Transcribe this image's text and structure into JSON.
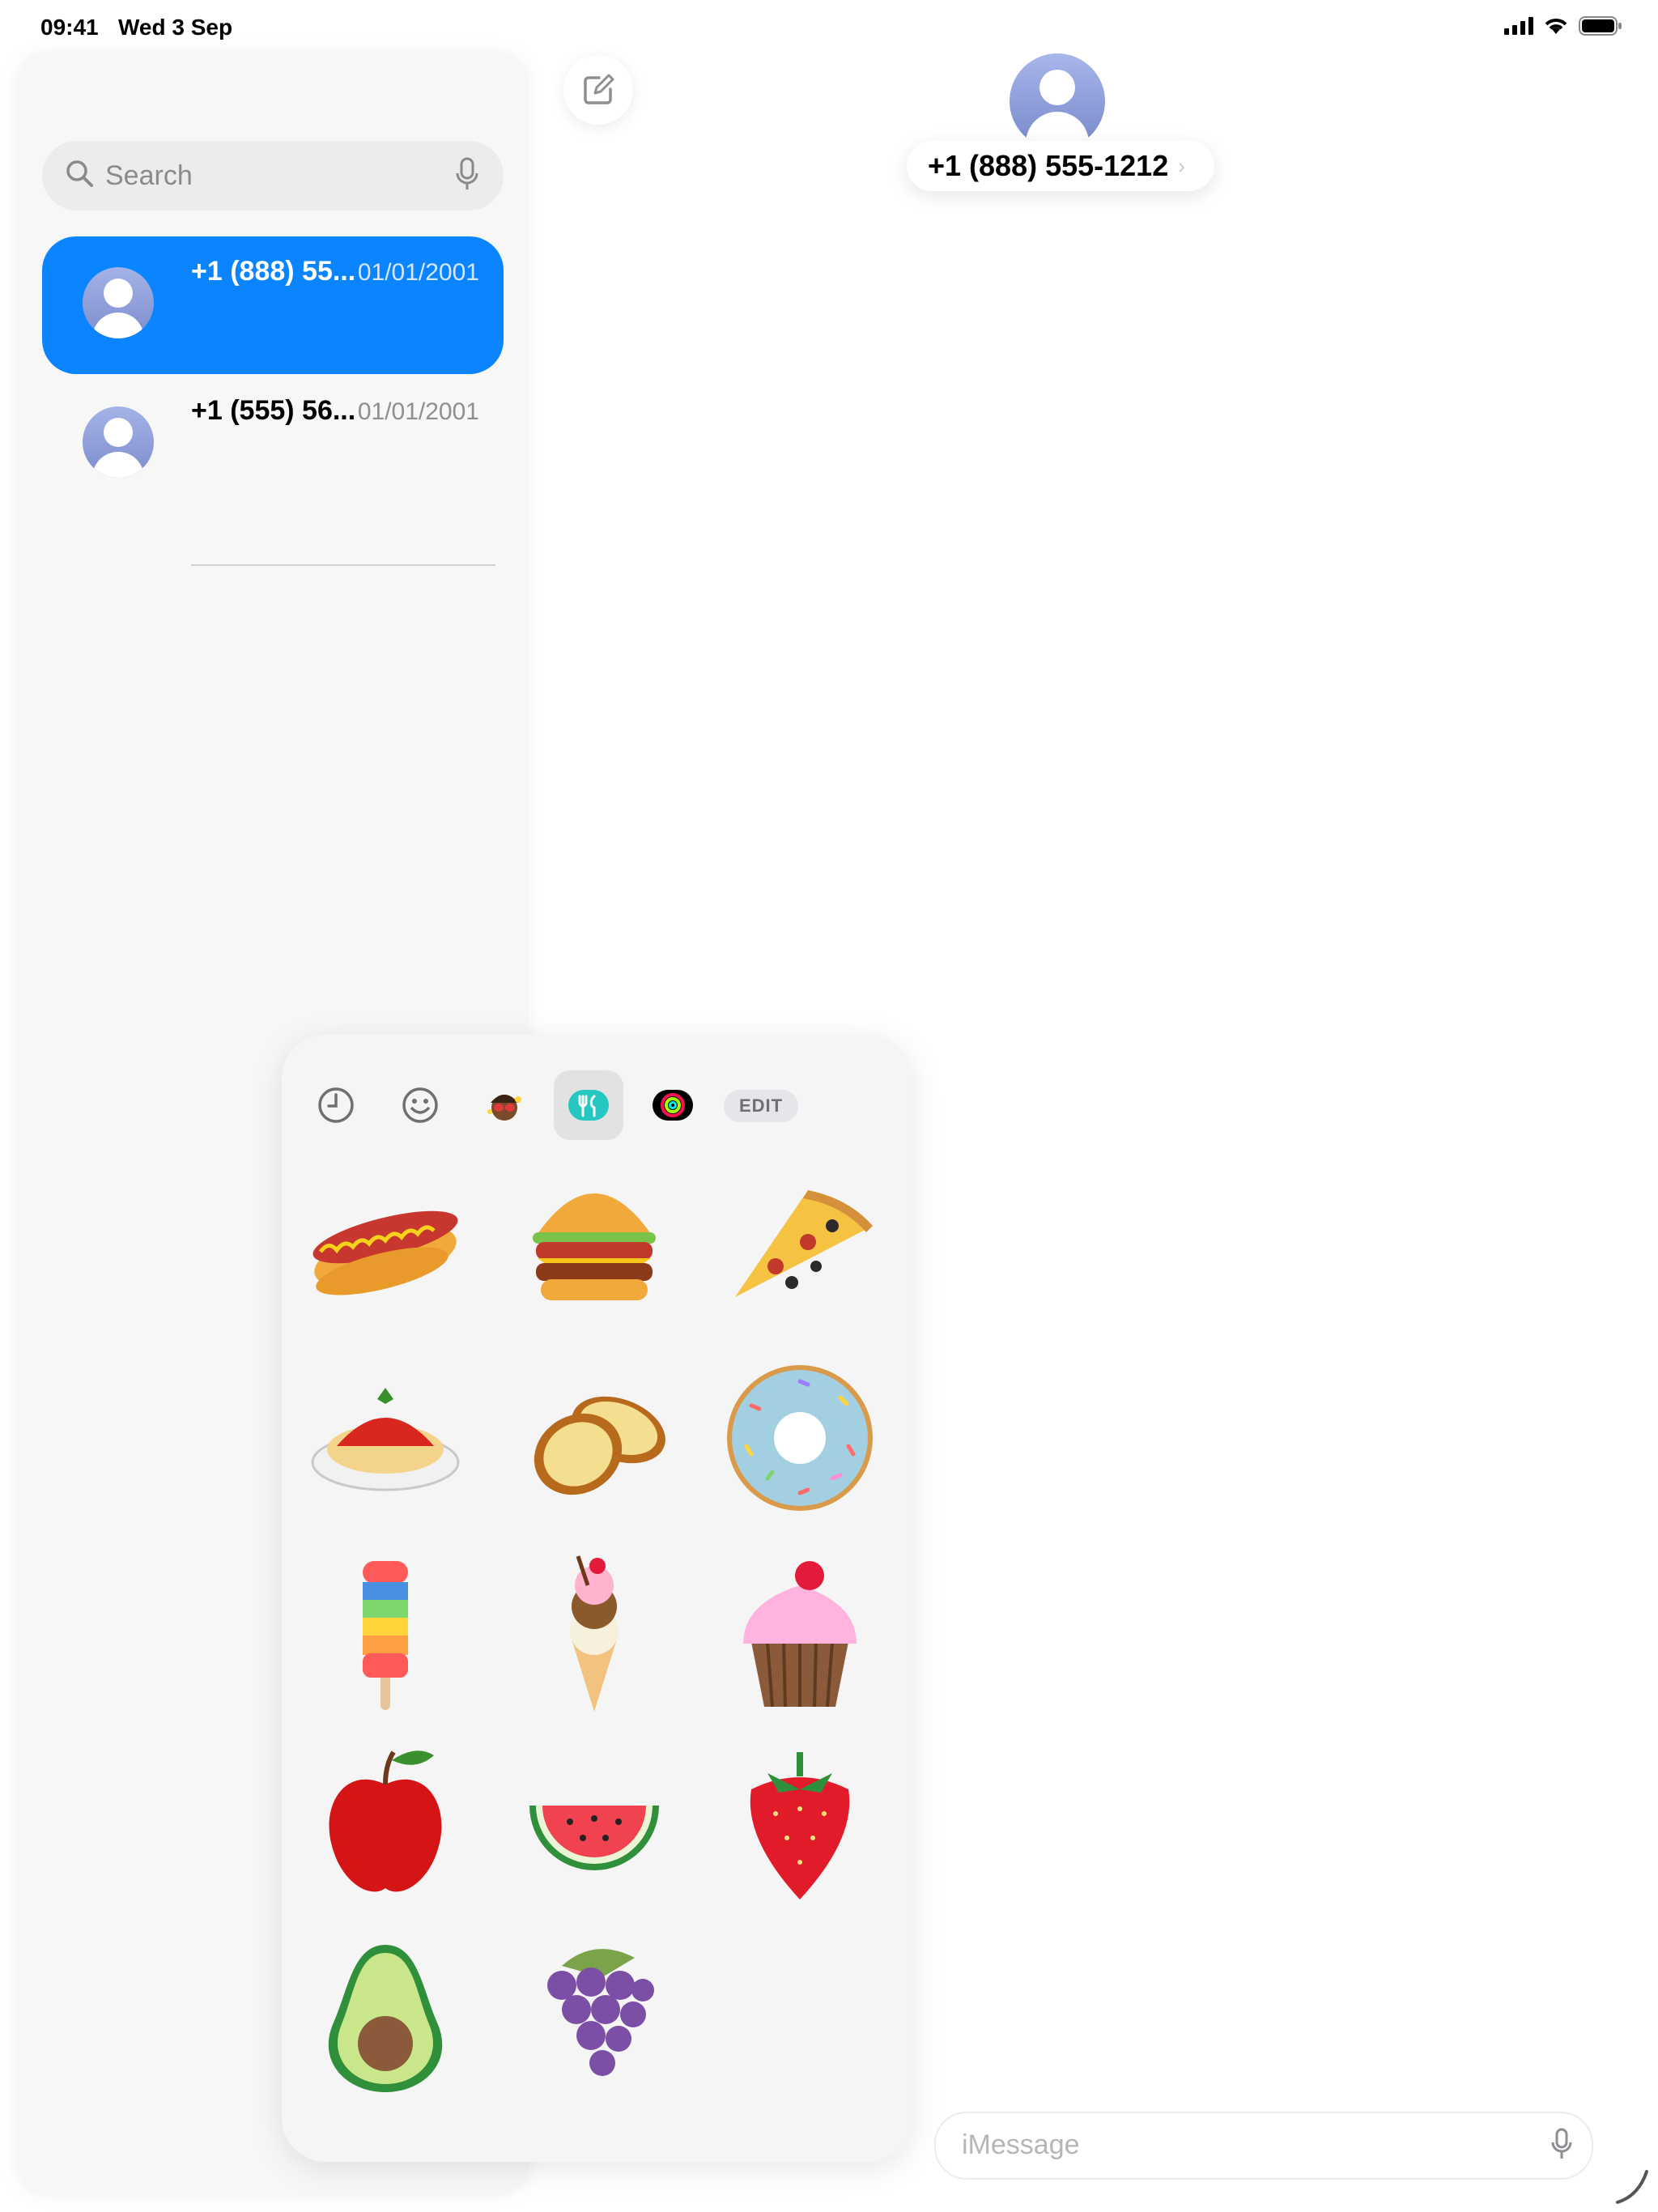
{
  "status_bar": {
    "time": "09:41",
    "date": "Wed 3 Sep",
    "icons": [
      "signal-icon",
      "wifi-icon",
      "battery-icon"
    ]
  },
  "sidebar": {
    "search": {
      "placeholder": "Search"
    },
    "conversations": [
      {
        "name": "+1 (888) 55...",
        "date": "01/01/2001",
        "selected": true
      },
      {
        "name": "+1 (555) 56...",
        "date": "01/01/2001",
        "selected": false
      }
    ]
  },
  "header": {
    "contact": "+1 (888) 555-1212"
  },
  "sticker_panel": {
    "tabs": [
      "recents-clock-icon",
      "emoji-smiley-icon",
      "memoji-icon",
      "food-stickers-icon",
      "activity-rings-icon"
    ],
    "active_tab": "food-stickers-icon",
    "edit_label": "EDIT",
    "stickers": [
      "hot-dog",
      "burger",
      "pizza-slice",
      "spaghetti",
      "garlic-bread",
      "donut",
      "popsicle",
      "ice-cream-cone",
      "cupcake",
      "apple",
      "watermelon",
      "strawberry",
      "avocado",
      "grapes"
    ]
  },
  "input": {
    "placeholder": "iMessage"
  },
  "colors": {
    "accent": "#0a84ff",
    "sidebar_bg": "#f7f7f7"
  }
}
